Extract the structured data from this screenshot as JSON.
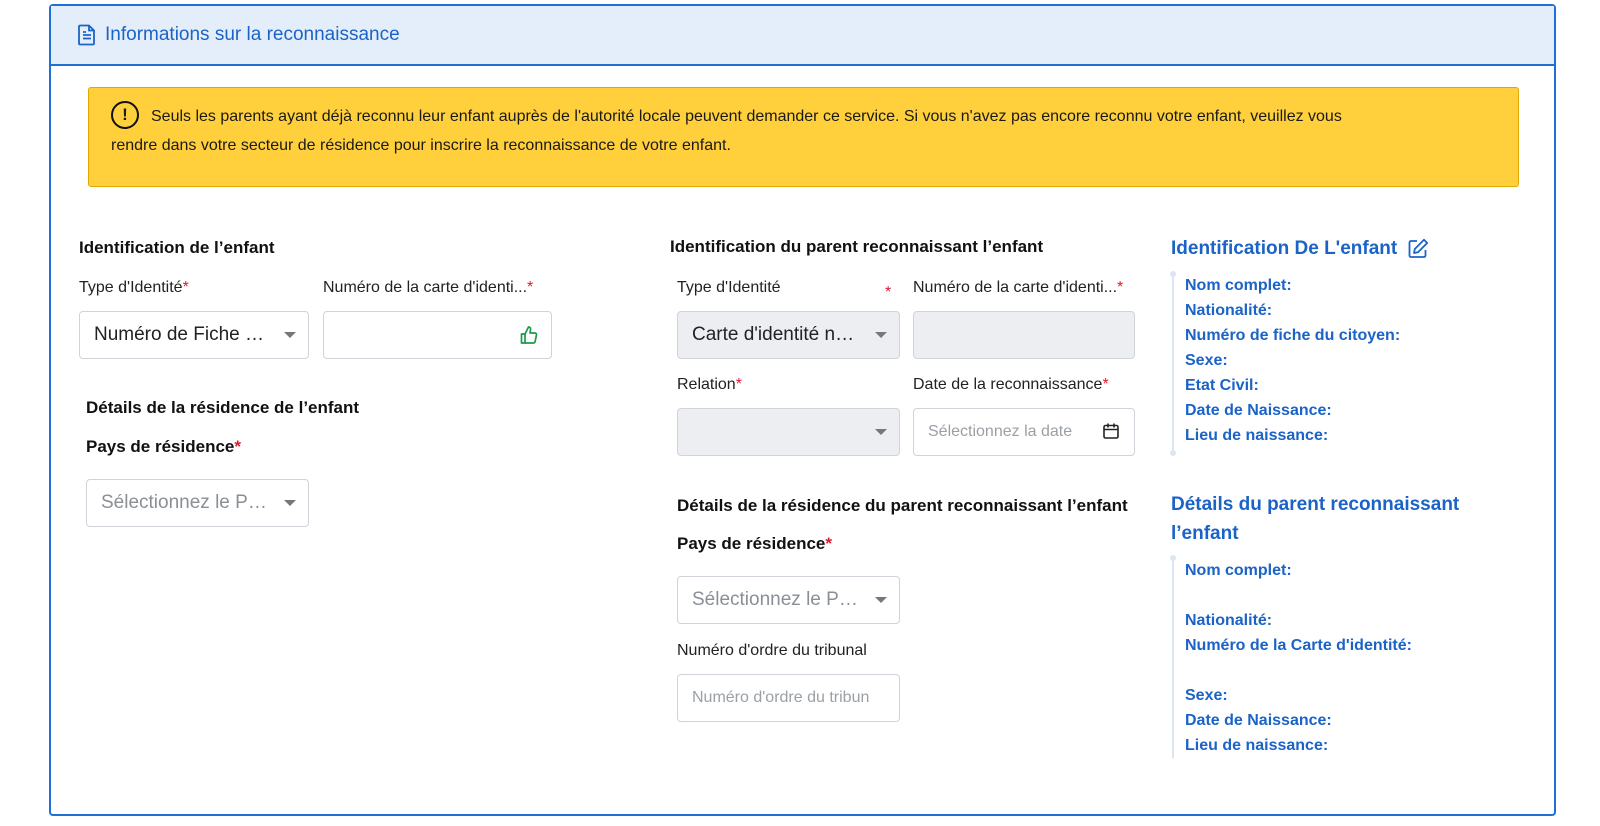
{
  "header": {
    "title": "Informations sur la reconnaissance",
    "icon": "document-icon"
  },
  "alert": {
    "line1": "Seuls les parents ayant déjà reconnu leur enfant auprès de l'autorité locale peuvent demander ce service. Si vous n'avez pas encore reconnu votre enfant, veuillez vous",
    "line2": "rendre dans votre secteur de résidence pour inscrire la reconnaissance de votre enfant.",
    "icon": "exclamation-circle-icon",
    "color": "#ffcf3c"
  },
  "child": {
    "section_title": "Identification de l’enfant",
    "id_type_label": "Type d'Identité",
    "id_type_value": "Numéro de Fiche d...",
    "id_number_label": "Numéro de la carte d'identi...",
    "id_number_value": "",
    "residence_title": "Détails de la résidence de l’enfant",
    "country_label": "Pays de résidence",
    "country_placeholder": "Sélectionnez le Pays"
  },
  "parent": {
    "section_title": "Identification du parent reconnaissant l’enfant",
    "id_type_label": "Type d'Identité",
    "id_type_value": "Carte d'identité na...",
    "id_number_label": "Numéro de la carte d'identi...",
    "relation_label": "Relation",
    "relation_value": "",
    "date_label": "Date de la reconnaissance",
    "date_placeholder": "Sélectionnez la date",
    "residence_title": "Détails de la résidence du parent reconnaissant l’enfant",
    "country_label": "Pays de résidence",
    "country_placeholder": "Sélectionnez le Pays",
    "tribunal_label": "Numéro d'ordre du tribunal",
    "tribunal_placeholder": "Numéro d'ordre du tribun"
  },
  "summary_child": {
    "title": "Identification De L'enfant",
    "items": [
      "Nom complet:",
      "Nationalité:",
      "Numéro de fiche du citoyen:",
      "Sexe:",
      "Etat Civil:",
      "Date de Naissance:",
      "Lieu de naissance:"
    ]
  },
  "summary_parent": {
    "title_line1": "Détails du parent reconnaissant",
    "title_line2": "l’enfant",
    "items": [
      "Nom complet:",
      "Nationalité:",
      "Numéro de la Carte d'identité:",
      "Sexe:",
      "Date de Naissance:",
      "Lieu de naissance:"
    ]
  },
  "required_mark": "*",
  "colors": {
    "accent": "#1b63c6",
    "success": "#1a9a4a",
    "required": "#e0182d"
  }
}
